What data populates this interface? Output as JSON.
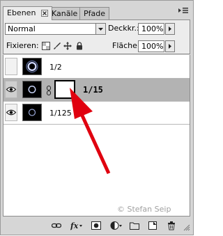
{
  "tabs": [
    {
      "label": "Ebenen",
      "active": true
    },
    {
      "label": "Kanäle",
      "active": false
    },
    {
      "label": "Pfade",
      "active": false
    }
  ],
  "blend_mode": "Normal",
  "opacity_label": "Deckkr.:",
  "opacity_value": "100%",
  "lock_label": "Fixieren:",
  "fill_label": "Fläche:",
  "fill_value": "100%",
  "layers": [
    {
      "name": "1/2",
      "visible": false,
      "selected": false,
      "has_mask": false
    },
    {
      "name": "1/15",
      "visible": true,
      "selected": true,
      "has_mask": true
    },
    {
      "name": "1/125",
      "visible": true,
      "selected": false,
      "has_mask": false
    }
  ],
  "watermark": "© Stefan Seip",
  "colors": {
    "annotation_arrow": "#e0000f",
    "selection": "#b3b3b3"
  },
  "footer_icons": [
    "link-icon",
    "fx-icon",
    "add-mask-icon",
    "adjustment-layer-icon",
    "group-folder-icon",
    "new-layer-icon",
    "trash-icon"
  ]
}
